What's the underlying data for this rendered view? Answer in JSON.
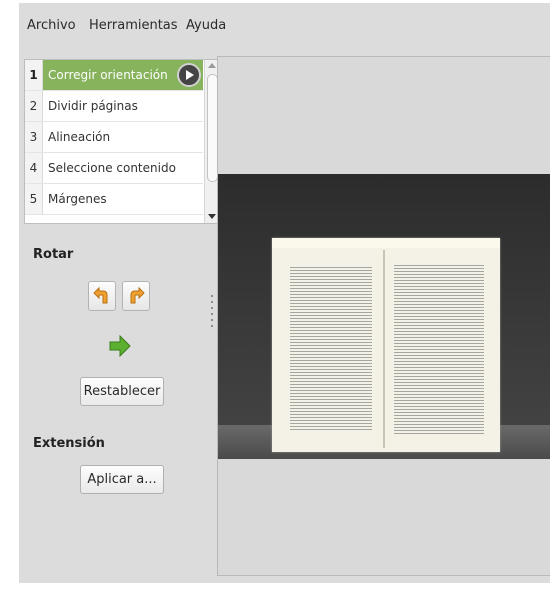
{
  "menu": {
    "items": [
      "Archivo",
      "Herramientas",
      "Ayuda"
    ]
  },
  "stages": [
    {
      "num": "1",
      "label": "Corregir orientación",
      "selected": true
    },
    {
      "num": "2",
      "label": "Dividir páginas",
      "selected": false
    },
    {
      "num": "3",
      "label": "Alineación",
      "selected": false
    },
    {
      "num": "4",
      "label": "Seleccione contenido",
      "selected": false
    },
    {
      "num": "5",
      "label": "Márgenes",
      "selected": false
    }
  ],
  "rotate": {
    "title": "Rotar",
    "reset_label": "Restablecer"
  },
  "extension": {
    "title": "Extensión",
    "apply_label": "Aplicar a..."
  },
  "colors": {
    "selected_stage": "#86b35c",
    "rotate_arrow": "#f0a030",
    "next_arrow": "#5cb030"
  }
}
